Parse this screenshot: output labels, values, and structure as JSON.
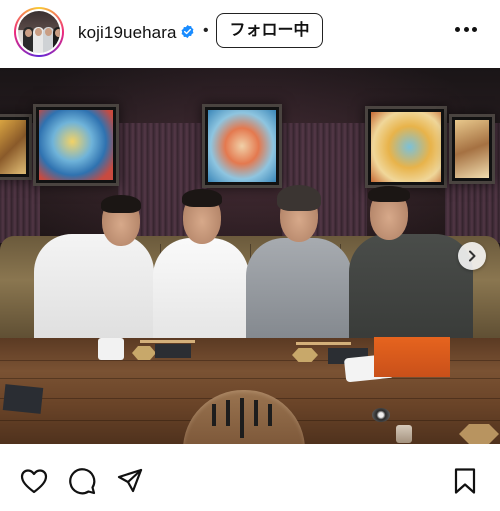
{
  "header": {
    "username": "koji19uehara",
    "separator": "•",
    "follow_label": "フォロー中",
    "verified": true
  },
  "post": {
    "carousel_has_next": true
  },
  "icons": {
    "avatar": "profile-avatar",
    "verified": "verified-badge-icon",
    "more": "more-options-icon",
    "next": "chevron-right-icon",
    "like": "heart-icon",
    "comment": "comment-bubble-icon",
    "share": "send-paper-plane-icon",
    "save": "bookmark-icon"
  },
  "colors": {
    "verified": "#1a8cff",
    "follow_border": "#222222",
    "story_ring_start": "#f9ce34",
    "story_ring_mid": "#ee2a7b",
    "story_ring_end": "#6228d7"
  }
}
